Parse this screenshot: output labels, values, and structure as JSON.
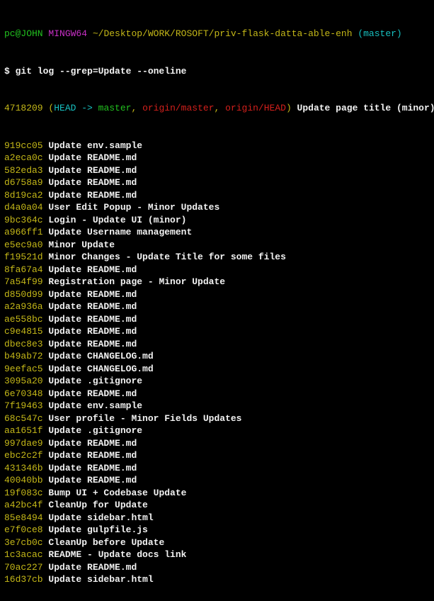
{
  "prompt": {
    "userhost": "pc@JOHN",
    "shell": "MINGW64",
    "cwd": "~/Desktop/WORK/ROSOFT/priv-flask-datta-able-enh",
    "branch": "(master)"
  },
  "command": "$ git log --grep=Update --oneline",
  "head_commit": {
    "hash": "4718209",
    "open": "(",
    "head_arrow": "HEAD -> ",
    "local_branch": "master",
    "sep1": ", ",
    "remote_branch": "origin/master",
    "sep2": ", ",
    "remote_head": "origin/HEAD",
    "close": ")",
    "message": " Update page title (minor)"
  },
  "commits": [
    {
      "hash": "919cc05",
      "message": "Update env.sample"
    },
    {
      "hash": "a2eca0c",
      "message": "Update README.md"
    },
    {
      "hash": "582eda3",
      "message": "Update README.md"
    },
    {
      "hash": "d6758a9",
      "message": "Update README.md"
    },
    {
      "hash": "8d19ca2",
      "message": "Update README.md"
    },
    {
      "hash": "d4a0a04",
      "message": "User Edit Popup - Minor Updates"
    },
    {
      "hash": "9bc364c",
      "message": "Login - Update UI (minor)"
    },
    {
      "hash": "a966ff1",
      "message": "Update Username management"
    },
    {
      "hash": "e5ec9a0",
      "message": "Minor Update"
    },
    {
      "hash": "f19521d",
      "message": "Minor Changes - Update Title for some files"
    },
    {
      "hash": "8fa67a4",
      "message": "Update README.md"
    },
    {
      "hash": "7a54f99",
      "message": "Registration page - Minor Update"
    },
    {
      "hash": "d850d99",
      "message": "Update README.md"
    },
    {
      "hash": "a2a936a",
      "message": "Update README.md"
    },
    {
      "hash": "ae558bc",
      "message": "Update README.md"
    },
    {
      "hash": "c9e4815",
      "message": "Update README.md"
    },
    {
      "hash": "dbec8e3",
      "message": "Update README.md"
    },
    {
      "hash": "b49ab72",
      "message": "Update CHANGELOG.md"
    },
    {
      "hash": "9eefac5",
      "message": "Update CHANGELOG.md"
    },
    {
      "hash": "3095a20",
      "message": "Update .gitignore"
    },
    {
      "hash": "6e70348",
      "message": "Update README.md"
    },
    {
      "hash": "7f19463",
      "message": "Update env.sample"
    },
    {
      "hash": "68c547c",
      "message": "User profile - Minor Fields Updates"
    },
    {
      "hash": "aa1651f",
      "message": "Update .gitignore"
    },
    {
      "hash": "997dae9",
      "message": "Update README.md"
    },
    {
      "hash": "ebc2c2f",
      "message": "Update README.md"
    },
    {
      "hash": "431346b",
      "message": "Update README.md"
    },
    {
      "hash": "40040bb",
      "message": "Update README.md"
    },
    {
      "hash": "19f083c",
      "message": "Bump UI + Codebase Update"
    },
    {
      "hash": "a42bc4f",
      "message": "CleanUp for Update"
    },
    {
      "hash": "85e8494",
      "message": "Update sidebar.html"
    },
    {
      "hash": "e7f0ce8",
      "message": "Update gulpfile.js"
    },
    {
      "hash": "3e7cb0c",
      "message": "CleanUp before Update"
    },
    {
      "hash": "1c3acac",
      "message": "README - Update docs link"
    },
    {
      "hash": "70ac227",
      "message": "Update README.md"
    },
    {
      "hash": "16d37cb",
      "message": "Update sidebar.html"
    }
  ]
}
